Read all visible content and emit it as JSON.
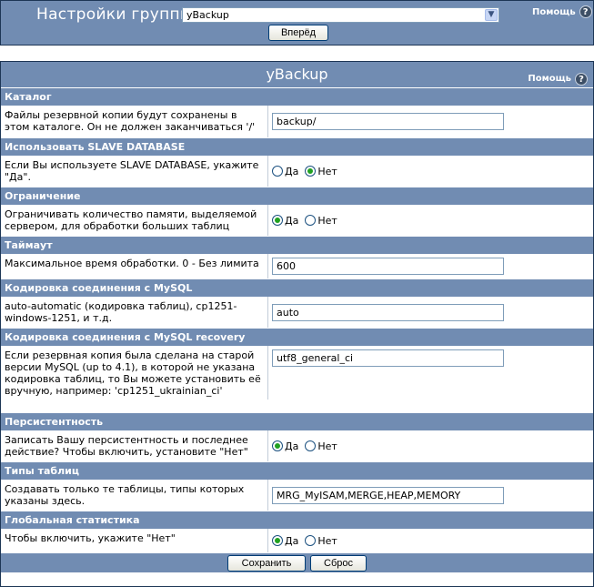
{
  "top": {
    "title": "Настройки группы",
    "group_select_value": "yBackup",
    "help_label": "Помощь",
    "forward_button": "Вперёд"
  },
  "main": {
    "title": "yBackup",
    "help_label": "Помощь"
  },
  "sections": [
    {
      "heading": "Каталог",
      "description": "Файлы резервной копии будут сохранены в этом каталоге. Он не должен заканчиваться '/'",
      "control": "text",
      "value": "backup/"
    },
    {
      "heading": "Использовать SLAVE DATABASE",
      "description": "Если Вы используете SLAVE DATABASE, укажите \"Да\".",
      "control": "radio",
      "yes_label": "Да",
      "no_label": "Нет",
      "selected": "no"
    },
    {
      "heading": "Ограничение",
      "description": "Ограничивать количество памяти, выделяемой сервером, для обработки больших таблиц",
      "control": "radio",
      "yes_label": "Да",
      "no_label": "Нет",
      "selected": "yes"
    },
    {
      "heading": "Таймаут",
      "description": "Максимальное время обработки. 0 - Без лимита",
      "control": "text",
      "value": "600"
    },
    {
      "heading": "Кодировка соединения с MySQL",
      "description": "auto-automatic (кодировка таблиц), cp1251-windows-1251, и т.д.",
      "control": "text",
      "value": "auto"
    },
    {
      "heading": "Кодировка соединения с MySQL recovery",
      "description": "Если резервная копия была сделана на старой версии MySQL (up to 4.1), в которой не указана кодировка таблиц, то Вы можете установить её вручную, например: 'cp1251_ukrainian_ci'",
      "control": "text",
      "value": "utf8_general_ci"
    },
    {
      "heading": "Персистентность",
      "description": "Записать Вашу персистентность и последнее действие? Чтобы включить, установите \"Нет\"",
      "control": "radio",
      "yes_label": "Да",
      "no_label": "Нет",
      "selected": "yes"
    },
    {
      "heading": "Типы таблиц",
      "description": "Создавать только те таблицы, типы которых указаны здесь.",
      "control": "text",
      "value": "MRG_MyISAM,MERGE,HEAP,MEMORY"
    },
    {
      "heading": "Глобальная статистика",
      "description": "Чтобы включить, укажите \"Нет\"",
      "control": "radio",
      "yes_label": "Да",
      "no_label": "Нет",
      "selected": "yes"
    }
  ],
  "footer": {
    "save_button": "Сохранить",
    "reset_button": "Сброс"
  }
}
